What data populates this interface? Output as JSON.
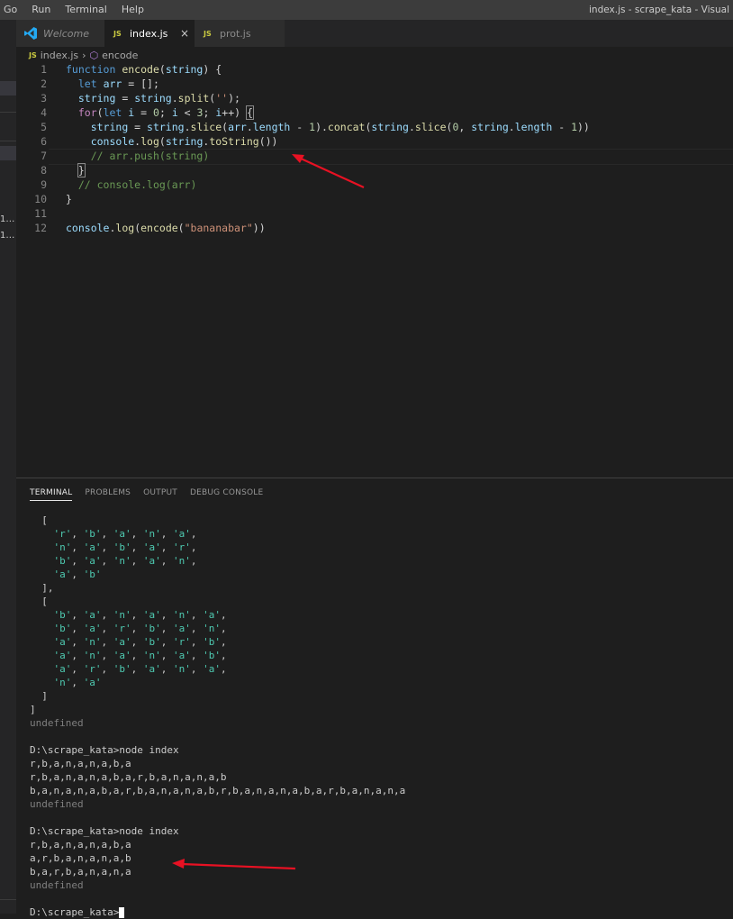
{
  "menu": [
    "Go",
    "Run",
    "Terminal",
    "Help"
  ],
  "window_title": "index.js - scrape_kata - Visual",
  "sidebar_fragments": [
    "1…",
    "1…"
  ],
  "tabs": [
    {
      "label": "Welcome",
      "icon": "vscode-icon"
    },
    {
      "label": "index.js",
      "icon": "JS",
      "close": "×"
    },
    {
      "label": "prot.js",
      "icon": "JS"
    }
  ],
  "breadcrumb": {
    "icon": "JS",
    "file": "index.js",
    "symbol": "encode"
  },
  "editor": {
    "line_numbers": [
      "1",
      "2",
      "3",
      "4",
      "5",
      "6",
      "7",
      "8",
      "9",
      "10",
      "11",
      "12"
    ]
  },
  "panel": {
    "tabs": [
      "TERMINAL",
      "PROBLEMS",
      "OUTPUT",
      "DEBUG CONSOLE"
    ]
  },
  "terminal": {
    "lines": [
      "  [",
      "    'r', 'b', 'a', 'n', 'a',",
      "    'n', 'a', 'b', 'a', 'r',",
      "    'b', 'a', 'n', 'a', 'n',",
      "    'a', 'b'",
      "  ],",
      "  [",
      "    'b', 'a', 'n', 'a', 'n', 'a',",
      "    'b', 'a', 'r', 'b', 'a', 'n',",
      "    'a', 'n', 'a', 'b', 'r', 'b',",
      "    'a', 'n', 'a', 'n', 'a', 'b',",
      "    'a', 'r', 'b', 'a', 'n', 'a',",
      "    'n', 'a'",
      "  ]",
      "]",
      "undefined",
      "",
      "D:\\scrape_kata>node index",
      "r,b,a,n,a,n,a,b,a",
      "r,b,a,n,a,n,a,b,a,r,b,a,n,a,n,a,b",
      "b,a,n,a,n,a,b,a,r,b,a,n,a,n,a,b,r,b,a,n,a,n,a,b,a,r,b,a,n,a,n,a",
      "undefined",
      "",
      "D:\\scrape_kata>node index",
      "r,b,a,n,a,n,a,b,a",
      "a,r,b,a,n,a,n,a,b",
      "b,a,r,b,a,n,a,n,a",
      "undefined",
      "",
      "D:\\scrape_kata>"
    ]
  },
  "colors": {
    "annotation_arrow": "#e81123",
    "background": "#1e1e1e",
    "js_icon": "#cbcb41"
  }
}
